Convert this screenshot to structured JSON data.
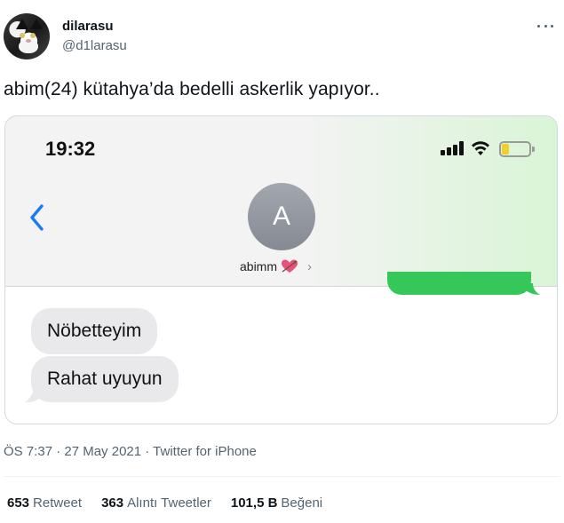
{
  "user": {
    "display_name": "dilarasu",
    "handle": "@d1larasu"
  },
  "tweet": {
    "text": "abim(24) kütahya’da bedelli askerlik yapıyor..",
    "timestamp": "ÖS 7:37 · 27 May 2021 · Twitter for iPhone"
  },
  "screenshot": {
    "status_time": "19:32",
    "battery_level": 0.25,
    "battery_color": "#f3cf2b",
    "contact_initial": "A",
    "contact_name": "abimm",
    "contact_emoji": "heart-with-arrow-icon",
    "sent_bubble_color": "#35c759",
    "received_bubble_color": "#e9e9eb",
    "messages": [
      {
        "from": "contact",
        "text": "Nöbetteyim"
      },
      {
        "from": "contact",
        "text": "Rahat uyuyun"
      }
    ]
  },
  "stats": {
    "retweets": {
      "count": "653",
      "label": "Retweet"
    },
    "quotes": {
      "count": "363",
      "label": "Alıntı Tweetler"
    },
    "likes": {
      "count": "101,5 B",
      "label": "Beğeni"
    }
  }
}
